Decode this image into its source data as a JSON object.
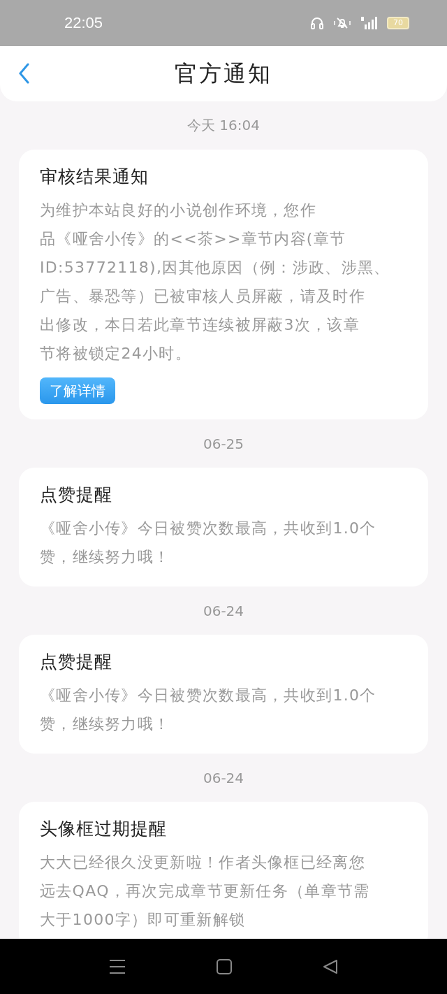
{
  "status_bar": {
    "time": "22:05",
    "battery": "70"
  },
  "header": {
    "title": "官方通知"
  },
  "groups": [
    {
      "date": "今天 16:04",
      "title": "审核结果通知",
      "lines": [
        "为维护本站良好的小说创作环境，您作",
        "品《哑舍小传》的<<茶>>章节内容(章节",
        "ID:53772118),因其他原因（例：涉政、涉黑、",
        "广告、暴恐等）已被审核人员屏蔽，请及时作",
        "出修改，本日若此章节连续被屏蔽3次，该章",
        "节将被锁定24小时。"
      ],
      "button": "了解详情"
    },
    {
      "date": "06-25",
      "title": "点赞提醒",
      "lines": [
        "《哑舍小传》今日被赞次数最高，共收到1.0个",
        "赞，继续努力哦！"
      ]
    },
    {
      "date": "06-24",
      "title": "点赞提醒",
      "lines": [
        "《哑舍小传》今日被赞次数最高，共收到1.0个",
        "赞，继续努力哦！"
      ]
    },
    {
      "date": "06-24",
      "title": "头像框过期提醒",
      "lines": [
        "大大已经很久没更新啦！作者头像框已经离您",
        "远去QAQ，再次完成章节更新任务（单章节需",
        "大于1000字）即可重新解锁"
      ]
    }
  ]
}
